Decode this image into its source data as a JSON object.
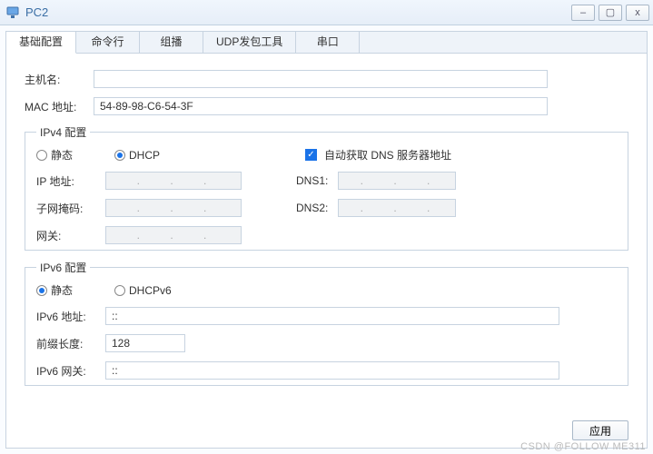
{
  "window": {
    "title": "PC2",
    "buttons": {
      "min": "–",
      "max": "▢",
      "close": "x"
    }
  },
  "tabs": [
    "基础配置",
    "命令行",
    "组播",
    "UDP发包工具",
    "串口"
  ],
  "active_tab_index": 0,
  "host": {
    "name_label": "主机名:",
    "name_value": "",
    "mac_label": "MAC 地址:",
    "mac_value": "54-89-98-C6-54-3F"
  },
  "ipv4": {
    "legend": "IPv4 配置",
    "radio_static": "静态",
    "radio_dhcp": "DHCP",
    "selected": "dhcp",
    "auto_dns_label": "自动获取 DNS 服务器地址",
    "auto_dns_checked": true,
    "ip_label": "IP 地址:",
    "ip_value": ".    .    .",
    "mask_label": "子网掩码:",
    "mask_value": ".    .    .",
    "gw_label": "网关:",
    "gw_value": ".    .    .",
    "dns1_label": "DNS1:",
    "dns1_value": ".    .    .",
    "dns2_label": "DNS2:",
    "dns2_value": ".    .    ."
  },
  "ipv6": {
    "legend": "IPv6 配置",
    "radio_static": "静态",
    "radio_dhcp": "DHCPv6",
    "selected": "static",
    "addr_label": "IPv6 地址:",
    "addr_value": "::",
    "prefix_label": "前缀长度:",
    "prefix_value": "128",
    "gw_label": "IPv6 网关:",
    "gw_value": "::"
  },
  "apply_label": "应用",
  "watermark": "CSDN @FOLLOW ME311"
}
